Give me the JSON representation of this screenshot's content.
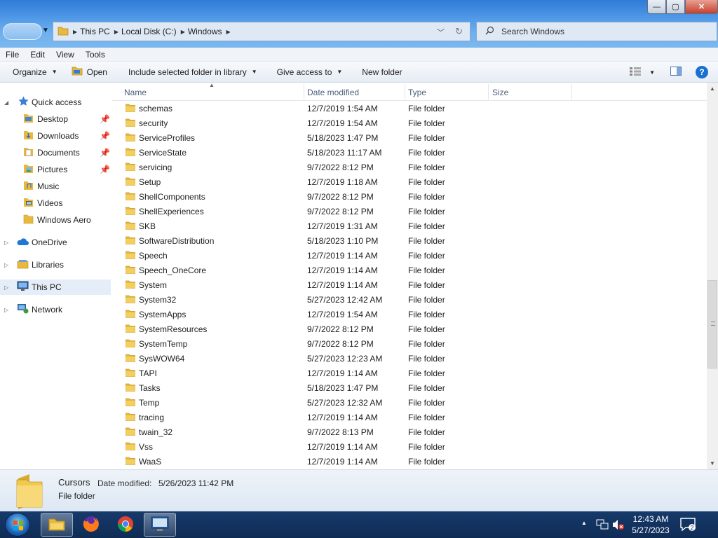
{
  "window": {
    "address": {
      "crumbs": [
        "This PC",
        "Local Disk (C:)",
        "Windows"
      ]
    },
    "search": {
      "placeholder": "Search Windows"
    },
    "caption_buttons": {
      "minimize": "—",
      "maximize": "▢",
      "close": "✕"
    }
  },
  "menu": [
    "File",
    "Edit",
    "View",
    "Tools"
  ],
  "toolbar": {
    "organize": "Organize",
    "open": "Open",
    "include": "Include selected folder in library",
    "share": "Give access to",
    "new_folder": "New folder"
  },
  "nav": {
    "quick_access": "Quick access",
    "quick_items": [
      "Desktop",
      "Downloads",
      "Documents",
      "Pictures",
      "Music",
      "Videos",
      "Windows Aero"
    ],
    "onedrive": "OneDrive",
    "libraries": "Libraries",
    "this_pc": "This PC",
    "network": "Network"
  },
  "columns": {
    "name": "Name",
    "date": "Date modified",
    "type": "Type",
    "size": "Size"
  },
  "rows": [
    {
      "name": "schemas",
      "date": "12/7/2019 1:54 AM",
      "type": "File folder"
    },
    {
      "name": "security",
      "date": "12/7/2019 1:54 AM",
      "type": "File folder"
    },
    {
      "name": "ServiceProfiles",
      "date": "5/18/2023 1:47 PM",
      "type": "File folder"
    },
    {
      "name": "ServiceState",
      "date": "5/18/2023 11:17 AM",
      "type": "File folder"
    },
    {
      "name": "servicing",
      "date": "9/7/2022 8:12 PM",
      "type": "File folder"
    },
    {
      "name": "Setup",
      "date": "12/7/2019 1:18 AM",
      "type": "File folder"
    },
    {
      "name": "ShellComponents",
      "date": "9/7/2022 8:12 PM",
      "type": "File folder"
    },
    {
      "name": "ShellExperiences",
      "date": "9/7/2022 8:12 PM",
      "type": "File folder"
    },
    {
      "name": "SKB",
      "date": "12/7/2019 1:31 AM",
      "type": "File folder"
    },
    {
      "name": "SoftwareDistribution",
      "date": "5/18/2023 1:10 PM",
      "type": "File folder"
    },
    {
      "name": "Speech",
      "date": "12/7/2019 1:14 AM",
      "type": "File folder"
    },
    {
      "name": "Speech_OneCore",
      "date": "12/7/2019 1:14 AM",
      "type": "File folder"
    },
    {
      "name": "System",
      "date": "12/7/2019 1:14 AM",
      "type": "File folder"
    },
    {
      "name": "System32",
      "date": "5/27/2023 12:42 AM",
      "type": "File folder"
    },
    {
      "name": "SystemApps",
      "date": "12/7/2019 1:54 AM",
      "type": "File folder"
    },
    {
      "name": "SystemResources",
      "date": "9/7/2022 8:12 PM",
      "type": "File folder"
    },
    {
      "name": "SystemTemp",
      "date": "9/7/2022 8:12 PM",
      "type": "File folder"
    },
    {
      "name": "SysWOW64",
      "date": "5/27/2023 12:23 AM",
      "type": "File folder"
    },
    {
      "name": "TAPI",
      "date": "12/7/2019 1:14 AM",
      "type": "File folder"
    },
    {
      "name": "Tasks",
      "date": "5/18/2023 1:47 PM",
      "type": "File folder"
    },
    {
      "name": "Temp",
      "date": "5/27/2023 12:32 AM",
      "type": "File folder"
    },
    {
      "name": "tracing",
      "date": "12/7/2019 1:14 AM",
      "type": "File folder"
    },
    {
      "name": "twain_32",
      "date": "9/7/2022 8:13 PM",
      "type": "File folder"
    },
    {
      "name": "Vss",
      "date": "12/7/2019 1:14 AM",
      "type": "File folder"
    },
    {
      "name": "WaaS",
      "date": "12/7/2019 1:14 AM",
      "type": "File folder"
    }
  ],
  "details": {
    "name": "Cursors",
    "date_label": "Date modified:",
    "date_value": "5/26/2023 11:42 PM",
    "type": "File folder"
  },
  "taskbar": {
    "time": "12:43 AM",
    "date": "5/27/2023",
    "notification_count": "2",
    "apps": [
      "file-explorer",
      "firefox",
      "chrome",
      "remote-desktop"
    ]
  },
  "colors": {
    "folder": "#e8b93c",
    "accent": "#1a6fd1",
    "selection": "#e5eef8"
  }
}
